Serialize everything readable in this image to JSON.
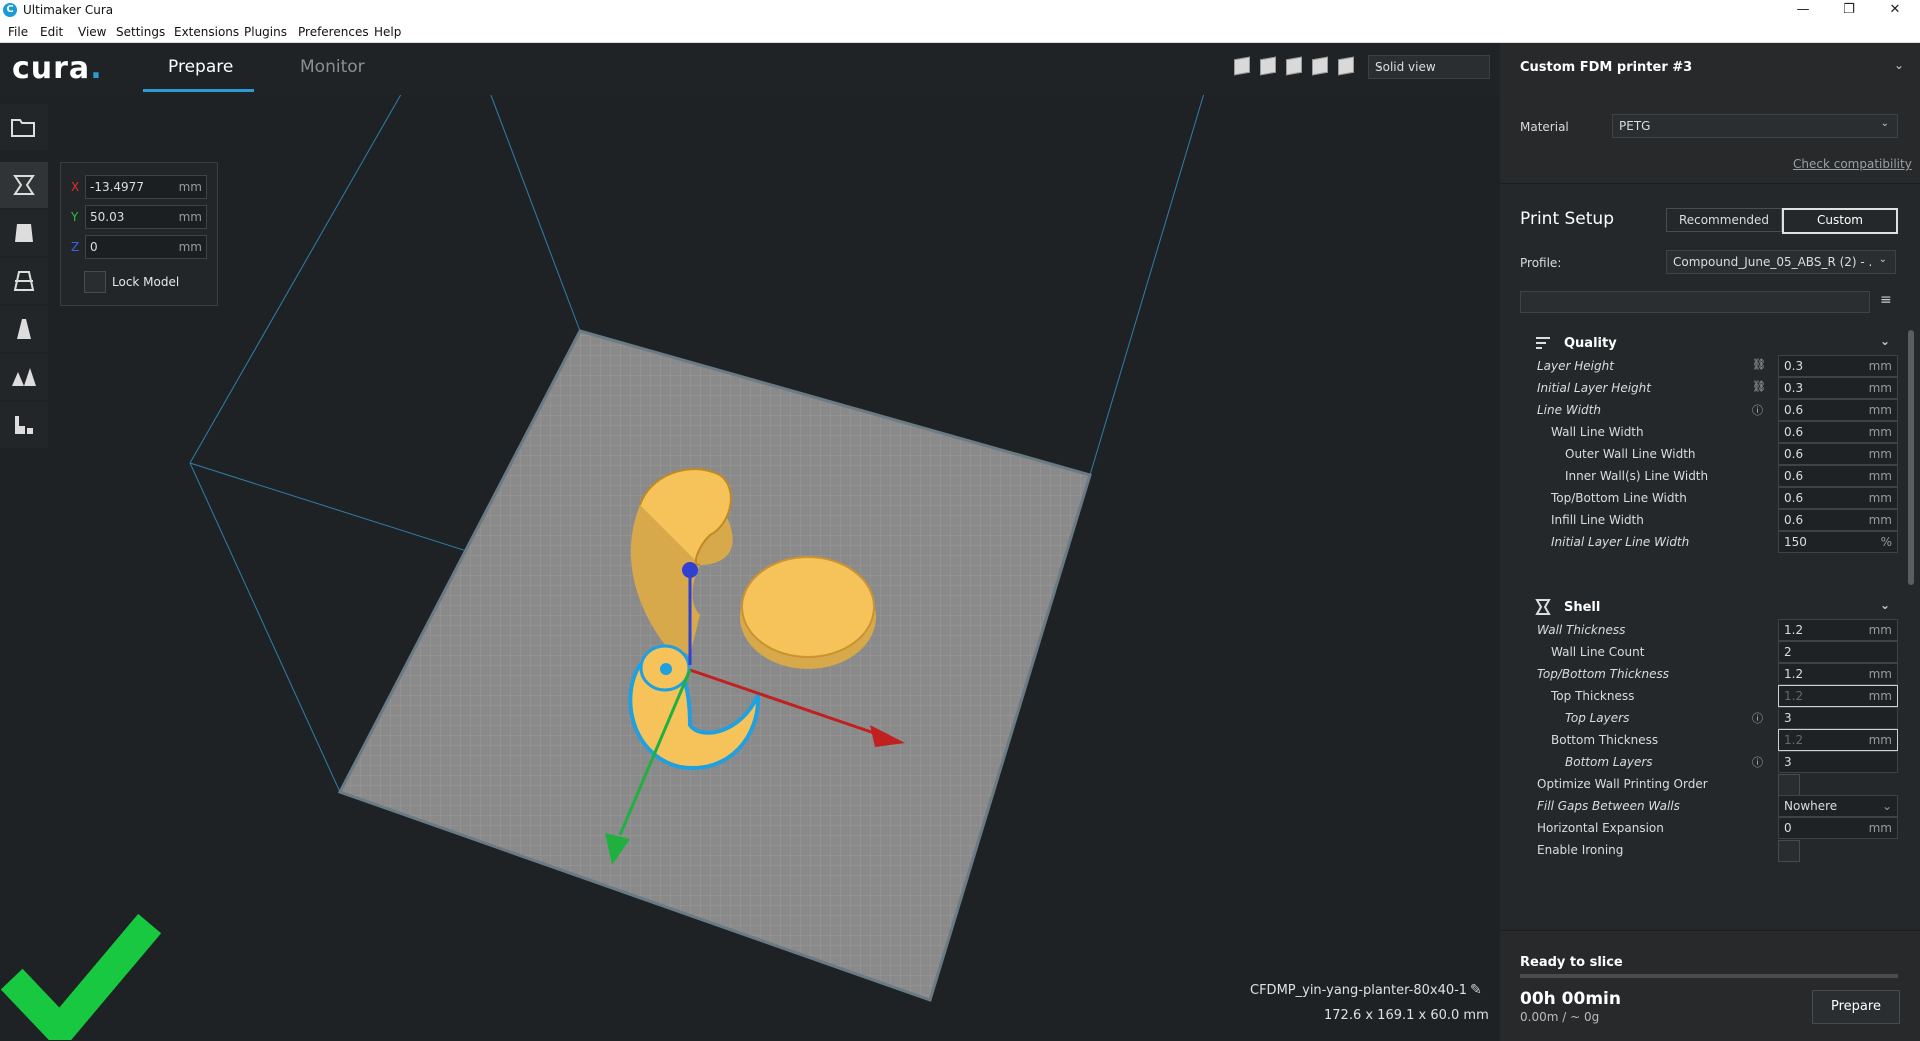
{
  "window": {
    "title": "Ultimaker Cura",
    "icon_letter": "C",
    "minimize": "—",
    "maximize": "❐",
    "close": "✕"
  },
  "menu": [
    "File",
    "Edit",
    "View",
    "Settings",
    "Extensions",
    "Plugins",
    "Preferences",
    "Help"
  ],
  "header": {
    "logo": "cura",
    "logo_dot": ".",
    "tabs": [
      {
        "label": "Prepare",
        "active": true
      },
      {
        "label": "Monitor",
        "active": false
      }
    ],
    "view_mode": "Solid view",
    "view_icons": [
      "3d-view-icon",
      "front-view-icon",
      "top-view-icon",
      "left-view-icon",
      "right-view-icon"
    ]
  },
  "toolbar": {
    "tools": [
      "open-file-icon",
      "move-tool-icon",
      "scale-tool-icon",
      "rotate-tool-icon",
      "mirror-tool-icon",
      "per-model-settings-icon",
      "support-blocker-icon"
    ],
    "active_tool": "move-tool-icon"
  },
  "move_panel": {
    "x": {
      "label": "X",
      "value": "-13.4977",
      "unit": "mm",
      "color": "#e03030"
    },
    "y": {
      "label": "Y",
      "value": "50.03",
      "unit": "mm",
      "color": "#30c030"
    },
    "z": {
      "label": "Z",
      "value": "0",
      "unit": "mm",
      "color": "#4060e0"
    },
    "lock_label": "Lock Model"
  },
  "sidebar": {
    "printer": "Custom FDM printer #3",
    "material_label": "Material",
    "material": "PETG",
    "check_compat": "Check compatibility",
    "print_setup": "Print Setup",
    "mode_recommended": "Recommended",
    "mode_custom": "Custom",
    "profile_label": "Profile:",
    "profile": "Compound_June_05_ABS_R (2) - ...",
    "categories": {
      "quality": "Quality",
      "shell": "Shell"
    },
    "settings": [
      {
        "label": "Layer Height",
        "italic": true,
        "indent": 0,
        "value": "0.3",
        "unit": "mm",
        "extra": "link-icon"
      },
      {
        "label": "Initial Layer Height",
        "italic": true,
        "indent": 0,
        "value": "0.3",
        "unit": "mm",
        "extra": "link-icon"
      },
      {
        "label": "Line Width",
        "italic": true,
        "indent": 0,
        "value": "0.6",
        "unit": "mm",
        "extra": "info-icon"
      },
      {
        "label": "Wall Line Width",
        "italic": false,
        "indent": 1,
        "value": "0.6",
        "unit": "mm"
      },
      {
        "label": "Outer Wall Line Width",
        "italic": false,
        "indent": 2,
        "value": "0.6",
        "unit": "mm"
      },
      {
        "label": "Inner Wall(s) Line Width",
        "italic": false,
        "indent": 2,
        "value": "0.6",
        "unit": "mm"
      },
      {
        "label": "Top/Bottom Line Width",
        "italic": false,
        "indent": 1,
        "value": "0.6",
        "unit": "mm"
      },
      {
        "label": "Infill Line Width",
        "italic": false,
        "indent": 1,
        "value": "0.6",
        "unit": "mm"
      },
      {
        "label": "Initial Layer Line Width",
        "italic": true,
        "indent": 1,
        "value": "150",
        "unit": "%"
      }
    ],
    "shell_settings": [
      {
        "label": "Wall Thickness",
        "italic": true,
        "indent": 0,
        "value": "1.2",
        "unit": "mm"
      },
      {
        "label": "Wall Line Count",
        "italic": false,
        "indent": 1,
        "value": "2",
        "unit": ""
      },
      {
        "label": "Top/Bottom Thickness",
        "italic": true,
        "indent": 0,
        "value": "1.2",
        "unit": "mm"
      },
      {
        "label": "Top Thickness",
        "italic": false,
        "indent": 1,
        "value": "1.2",
        "unit": "mm",
        "dim": true,
        "active": true
      },
      {
        "label": "Top Layers",
        "italic": true,
        "indent": 2,
        "value": "3",
        "unit": "",
        "extra": "info-icon"
      },
      {
        "label": "Bottom Thickness",
        "italic": false,
        "indent": 1,
        "value": "1.2",
        "unit": "mm",
        "dim": true,
        "active": true
      },
      {
        "label": "Bottom Layers",
        "italic": true,
        "indent": 2,
        "value": "3",
        "unit": "",
        "extra": "info-icon"
      },
      {
        "label": "Optimize Wall Printing Order",
        "italic": false,
        "indent": 0,
        "checkbox": true
      },
      {
        "label": "Fill Gaps Between Walls",
        "italic": true,
        "indent": 0,
        "value": "Nowhere",
        "unit": "",
        "dropdown": true
      },
      {
        "label": "Horizontal Expansion",
        "italic": false,
        "indent": 0,
        "value": "0",
        "unit": "mm"
      },
      {
        "label": "Enable Ironing",
        "italic": false,
        "indent": 0,
        "checkbox": true
      }
    ]
  },
  "slice": {
    "status": "Ready to slice",
    "time": "00h 00min",
    "material_info": "0.00m / ~ 0g",
    "prepare_button": "Prepare"
  },
  "object": {
    "name": "CFDMP_yin-yang-planter-80x40-1",
    "dimensions": "172.6 x 169.1 x 60.0 mm"
  },
  "colors": {
    "accent": "#2a9bd7",
    "model": "#f5c35a",
    "selected_outline": "#1fa0e0",
    "checkmark": "#18c840"
  }
}
